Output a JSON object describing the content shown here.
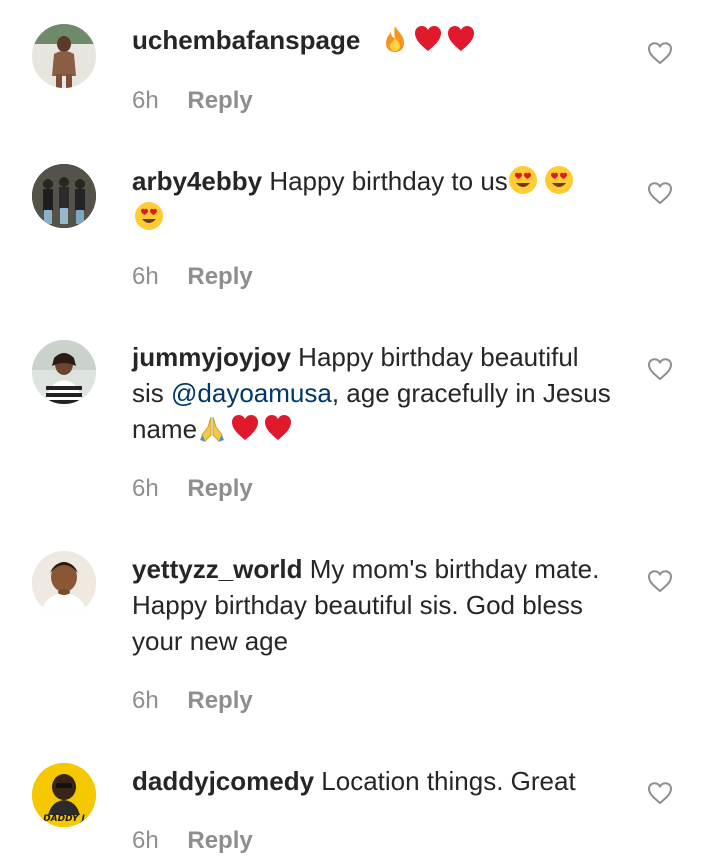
{
  "comments": [
    {
      "username": "uchembafanspage",
      "text": "",
      "emojis": [
        "fire-emoji",
        "red-heart-emoji",
        "red-heart-emoji"
      ],
      "time": "6h",
      "reply_label": "Reply"
    },
    {
      "username": "arby4ebby",
      "text": "Happy birthday to us",
      "emojis": [
        "heart-eyes-emoji",
        "heart-eyes-emoji",
        "heart-eyes-emoji"
      ],
      "time": "6h",
      "reply_label": "Reply"
    },
    {
      "username": "jummyjoyjoy",
      "text_before": "Happy birthday beautiful sis",
      "mention": "@dayoamusa",
      "text_after": ", age gracefully in Jesus name",
      "emojis": [
        "folded-hands-emoji",
        "red-heart-emoji",
        "red-heart-emoji"
      ],
      "time": "6h",
      "reply_label": "Reply"
    },
    {
      "username": "yettyzz_world",
      "text": "My mom's birthday mate. Happy birthday beautiful sis. God bless your new age",
      "time": "6h",
      "reply_label": "Reply"
    },
    {
      "username": "daddyjcomedy",
      "text": "Location things. Great",
      "avatar_text": "DADDY J",
      "time": "6h",
      "reply_label": "Reply"
    }
  ],
  "colors": {
    "username": "#262626",
    "body_text": "#262626",
    "meta": "#8e8e8e",
    "mention": "#00376b",
    "heart_outline": "#8e8e8e"
  }
}
